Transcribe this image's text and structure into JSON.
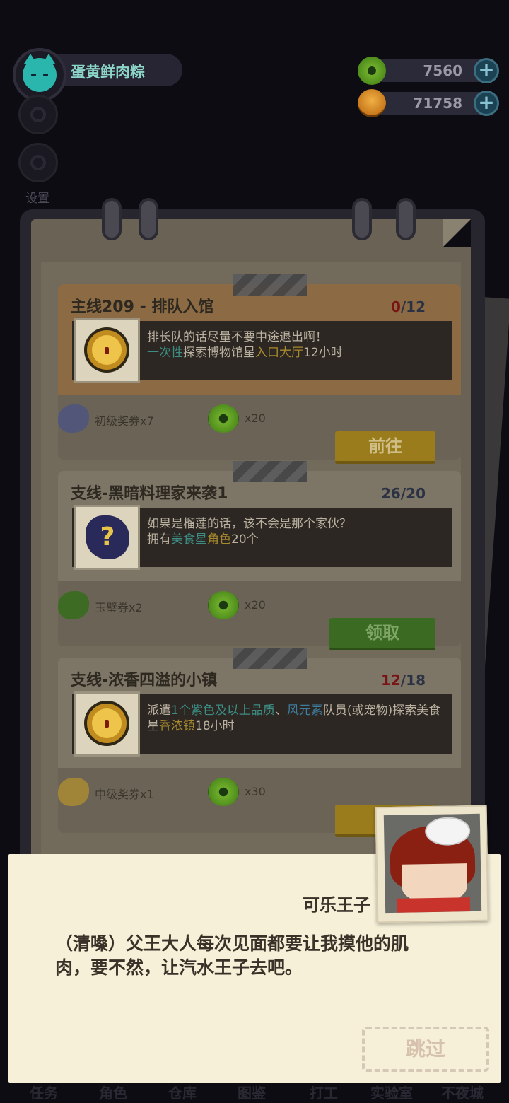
{
  "player": {
    "name": "蛋黄鲜肉粽"
  },
  "side": {
    "settings_label": "设置"
  },
  "currencies": [
    {
      "icon": "green-coin-icon",
      "value": "7560"
    },
    {
      "icon": "orange-planet-icon",
      "value": "71758"
    }
  ],
  "quests": [
    {
      "title": "主线209 - 排队入馆",
      "progress_current": "0",
      "progress_total": "/12",
      "desc_line1": "排长队的话尽量不要中途退出啊！",
      "desc_line2_parts": [
        "一次性",
        "探索博物馆星",
        "入口大厅",
        "12小时"
      ],
      "rewards": [
        {
          "icon": "blue-ticket-icon",
          "label": "初级奖券x7"
        },
        {
          "icon": "green-coin-icon",
          "label": "x20"
        }
      ],
      "button": "前往"
    },
    {
      "title": "支线-黑暗料理家来袭1",
      "progress_current": "26",
      "progress_total": "/20",
      "desc_line1": "如果是榴莲的话，该不会是那个家伙？",
      "desc_line2_parts": [
        "拥有",
        "美食星",
        "角色",
        "20个"
      ],
      "rewards": [
        {
          "icon": "green-ticket-icon",
          "label": "玉璧券x2"
        },
        {
          "icon": "green-coin-icon",
          "label": "x20"
        }
      ],
      "button": "领取"
    },
    {
      "title": "支线-浓香四溢的小镇",
      "progress_current": "12",
      "progress_total": "/18",
      "desc_parts": [
        "派遣",
        "1个紫色及以上品质",
        "、",
        "风元素",
        "队员(或宠物)探索美食星",
        "香浓镇",
        "18小时"
      ],
      "rewards": [
        {
          "icon": "gold-ticket-icon",
          "label": "中级奖券x1"
        },
        {
          "icon": "green-coin-icon",
          "label": "x30"
        }
      ],
      "button": "前"
    }
  ],
  "dialog": {
    "speaker": "可乐王子",
    "text_line1": "（清嗓）父王大人每次见面都要让我摸他的肌",
    "text_line2": "肉，要不然，让汽水王子去吧。",
    "skip": "跳过"
  },
  "bottom_nav": [
    "任务",
    "角色",
    "仓库",
    "图鉴",
    "打工",
    "实验室",
    "不夜城"
  ]
}
